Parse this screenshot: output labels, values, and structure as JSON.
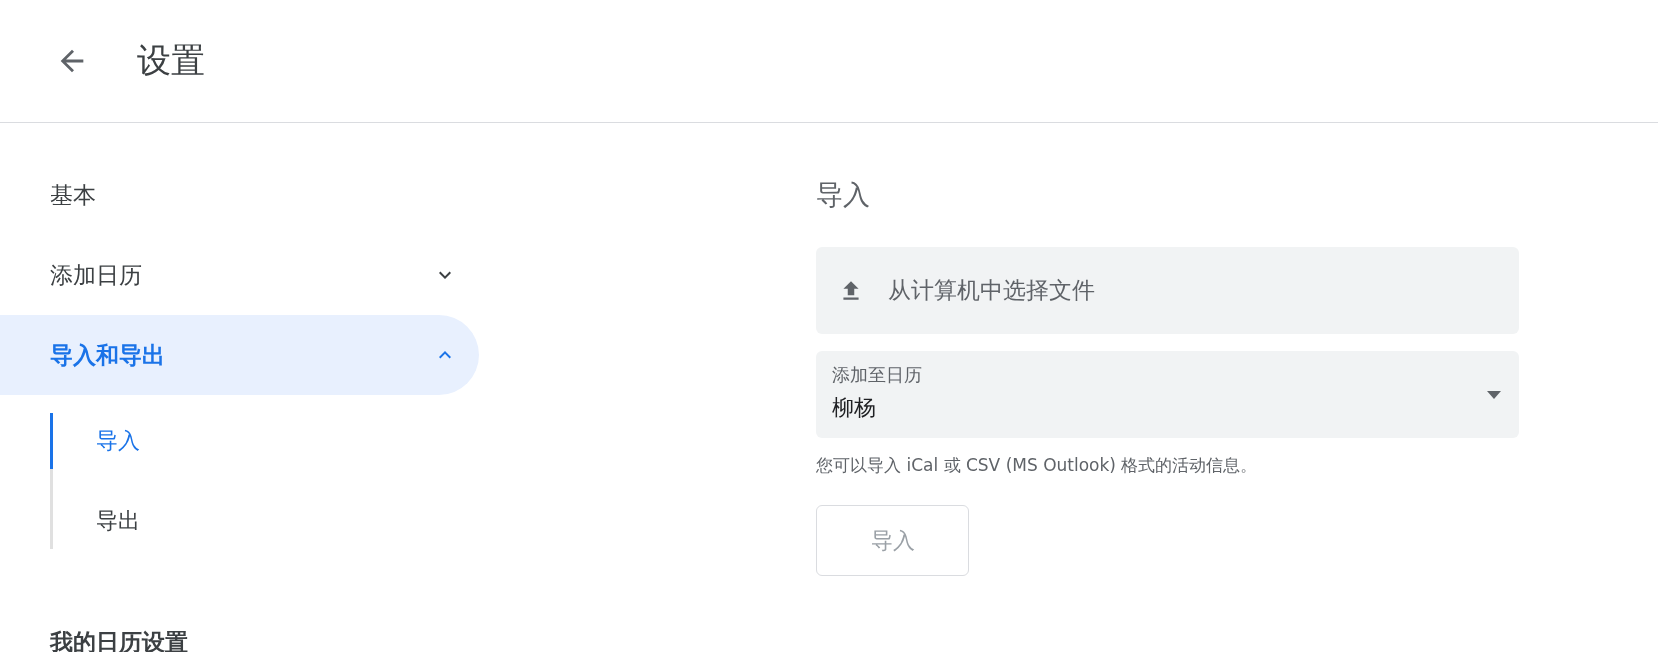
{
  "header": {
    "title": "设置"
  },
  "sidebar": {
    "items": [
      {
        "label": "基本",
        "kind": "link",
        "selected": false
      },
      {
        "label": "添加日历",
        "kind": "group",
        "expanded": false,
        "selected": false
      },
      {
        "label": "导入和导出",
        "kind": "group",
        "expanded": true,
        "selected": true,
        "children": [
          {
            "label": "导入",
            "selected": true
          },
          {
            "label": "导出",
            "selected": false
          }
        ]
      }
    ],
    "section_heading": "我的日历设置"
  },
  "content": {
    "heading": "导入",
    "file_button": "从计算机中选择文件",
    "calendar_select": {
      "label": "添加至日历",
      "value": "柳杨"
    },
    "hint": "您可以导入 iCal 或 CSV (MS Outlook) 格式的活动信息。",
    "import_button": {
      "label": "导入",
      "disabled": true
    }
  }
}
